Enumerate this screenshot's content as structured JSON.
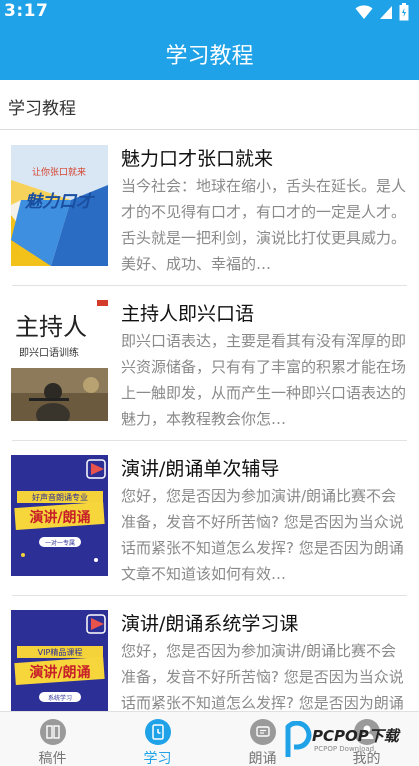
{
  "status_bar": {
    "time": "3:17"
  },
  "app_bar": {
    "title": "学习教程"
  },
  "section": {
    "title": "学习教程"
  },
  "courses": [
    {
      "title": "魅力口才张口就来",
      "description": "当今社会：地球在缩小，舌头在延长。是人才的不见得有口才，有口才的一定是人才。 舌头就是一把利剑，演说比打仗更具威力。 美好、成功、幸福的…",
      "thumb_lines": [
        "让你张口就来",
        "魅力口才"
      ]
    },
    {
      "title": "主持人即兴口语",
      "description": "即兴口语表达，主要是看其有没有浑厚的即兴资源储备，只有有了丰富的积累才能在场上一触即发，从而产生一种即兴口语表达的魅力，本教程教会你怎…",
      "thumb_lines": [
        "主持人",
        "即兴口语训练"
      ]
    },
    {
      "title": "演讲/朗诵单次辅导",
      "description": "您好，您是否因为参加演讲/朗诵比赛不会准备，发音不好所苦恼? 您是否因为当众说话而紧张不知道怎么发挥? 您是否因为朗诵文章不知道该如何有效…",
      "thumb_lines": [
        "好声音朗诵专业",
        "演讲/朗诵",
        "一对一专属"
      ]
    },
    {
      "title": "演讲/朗诵系统学习课",
      "description": "您好，您是否因为参加演讲/朗诵比赛不会准备，发音不好所苦恼? 您是否因为当众说话而紧张不知道怎么发挥? 您是否因为朗诵文章不知道该如何有效…",
      "thumb_lines": [
        "VIP精品课程",
        "演讲/朗诵",
        "系统学习"
      ]
    }
  ],
  "bottom_nav": [
    {
      "label": "稿件",
      "icon": "book-icon"
    },
    {
      "label": "学习",
      "icon": "study-icon"
    },
    {
      "label": "朗诵",
      "icon": "recite-icon"
    },
    {
      "label": "我的",
      "icon": "profile-icon"
    }
  ],
  "watermark": {
    "brand": "PCPOP下载",
    "sub": "PCPOP Download"
  },
  "colors": {
    "primary": "#1fa2e8",
    "text": "#111111",
    "muted": "#8a8a8a"
  }
}
